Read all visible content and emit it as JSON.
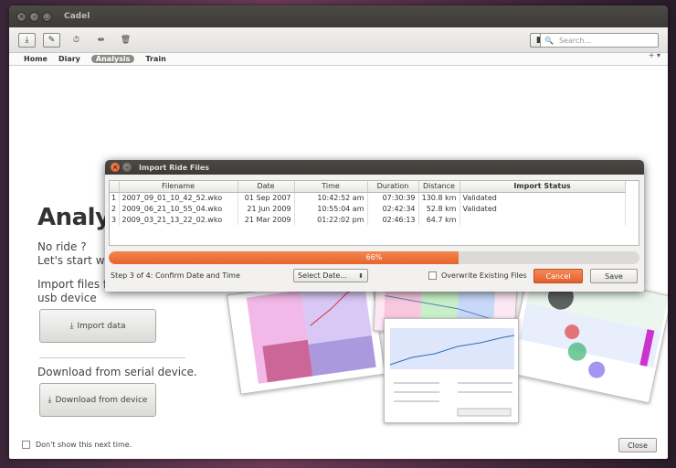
{
  "window": {
    "title": "Cadel"
  },
  "search": {
    "placeholder": "Search..."
  },
  "tabs": [
    {
      "label": "Home"
    },
    {
      "label": "Diary"
    },
    {
      "label": "Analysis"
    },
    {
      "label": "Train"
    }
  ],
  "tab_plus": "+ ▾",
  "main": {
    "heading": "Analy",
    "no_ride_line1": "No ride ?",
    "no_ride_line2": "Let's start w",
    "import_line1": "Import files fr",
    "import_line2": "usb device",
    "import_button": "Import data",
    "serial_text": "Download from serial device.",
    "download_button": "Download from device"
  },
  "footer": {
    "dont_show": "Don't show this next time.",
    "close": "Close"
  },
  "dialog": {
    "title": "Import Ride Files",
    "columns": [
      "Filename",
      "Date",
      "Time",
      "Duration",
      "Distance",
      "Import Status"
    ],
    "rows": [
      {
        "num": "1",
        "filename": "2007_09_01_10_42_52.wko",
        "date": "01 Sep 2007",
        "time": "10:42:52 am",
        "duration": "07:30:39",
        "distance": "130.8 km",
        "status": "Validated"
      },
      {
        "num": "2",
        "filename": "2009_06_21_10_55_04.wko",
        "date": "21 Jun 2009",
        "time": "10:55:04 am",
        "duration": "02:42:34",
        "distance": "52.8 km",
        "status": "Validated"
      },
      {
        "num": "3",
        "filename": "2009_03_21_13_22_02.wko",
        "date": "21 Mar 2009",
        "time": "01:22:02 pm",
        "duration": "02:46:13",
        "distance": "64.7 km",
        "status": "Validated"
      }
    ],
    "progress": 0.66,
    "progress_label": "66%",
    "step": "Step 3 of 4: Confirm Date and Time",
    "select_date": "Select Date...",
    "overwrite": "Overwrite Existing Files",
    "cancel": "Cancel",
    "save": "Save"
  },
  "colors": {
    "accent": "#e5642c",
    "titlebar": "#3c3b37"
  }
}
